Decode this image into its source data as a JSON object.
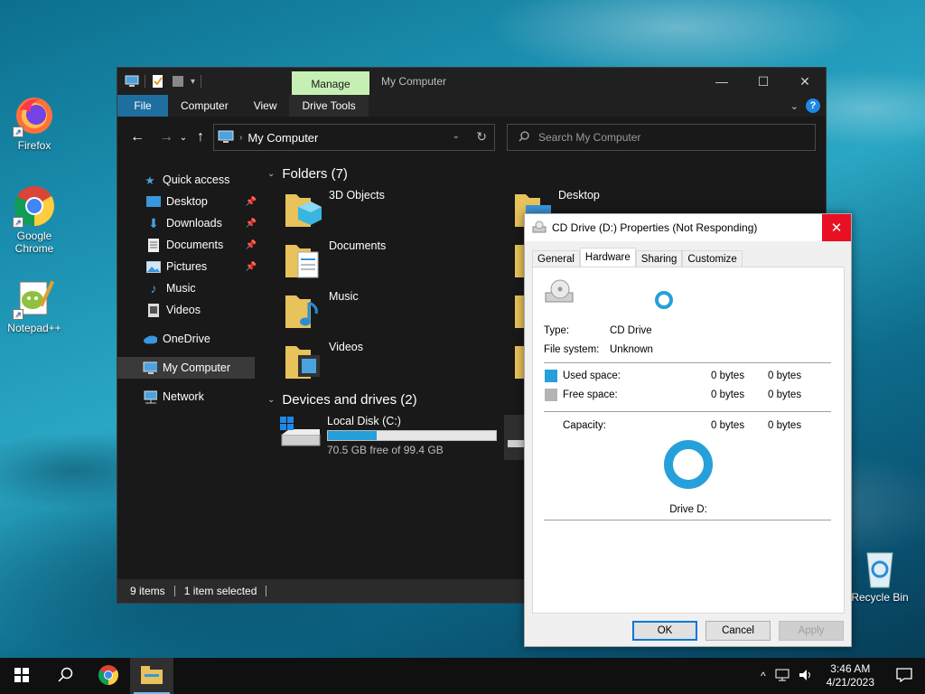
{
  "desktop": {
    "icons": [
      {
        "label": "Firefox"
      },
      {
        "label": "Google Chrome"
      },
      {
        "label": "Notepad++"
      },
      {
        "label": "Recycle Bin"
      }
    ]
  },
  "explorer": {
    "manage_tab": "Manage",
    "title": "My Computer",
    "ribbon_tabs": [
      "File",
      "Computer",
      "View",
      "Drive Tools"
    ],
    "address": {
      "crumb": "My Computer"
    },
    "search": {
      "placeholder": "Search My Computer"
    },
    "nav": {
      "quick_access": "Quick access",
      "items": [
        {
          "label": "Desktop",
          "pinned": true
        },
        {
          "label": "Downloads",
          "pinned": true
        },
        {
          "label": "Documents",
          "pinned": true
        },
        {
          "label": "Pictures",
          "pinned": true
        },
        {
          "label": "Music",
          "pinned": false
        },
        {
          "label": "Videos",
          "pinned": false
        }
      ],
      "onedrive": "OneDrive",
      "my_computer": "My Computer",
      "network": "Network"
    },
    "folders_header": "Folders (7)",
    "folders": [
      "3D Objects",
      "Desktop",
      "Documents",
      "Music",
      "Videos"
    ],
    "devices_header": "Devices and drives (2)",
    "drive_c": {
      "name": "Local Disk (C:)",
      "free": "70.5 GB free of 99.4 GB",
      "used_fraction": 0.291
    },
    "status": {
      "items": "9 items",
      "selected": "1 item selected"
    }
  },
  "dialog": {
    "title": "CD Drive (D:) Properties (Not Responding)",
    "tabs": [
      "General",
      "Hardware",
      "Sharing",
      "Customize"
    ],
    "active_tab": "Hardware",
    "type_label": "Type:",
    "type_value": "CD Drive",
    "fs_label": "File system:",
    "fs_value": "Unknown",
    "used_label": "Used space:",
    "used_bytes": "0 bytes",
    "used_bytes2": "0 bytes",
    "free_label": "Free space:",
    "free_bytes": "0 bytes",
    "free_bytes2": "0 bytes",
    "capacity_label": "Capacity:",
    "cap_bytes": "0 bytes",
    "cap_bytes2": "0 bytes",
    "drive_label": "Drive D:",
    "buttons": {
      "ok": "OK",
      "cancel": "Cancel",
      "apply": "Apply"
    },
    "colors": {
      "used": "#26a0da",
      "free": "#b4b4b4"
    }
  },
  "taskbar": {
    "time": "3:46 AM",
    "date": "4/21/2023"
  }
}
